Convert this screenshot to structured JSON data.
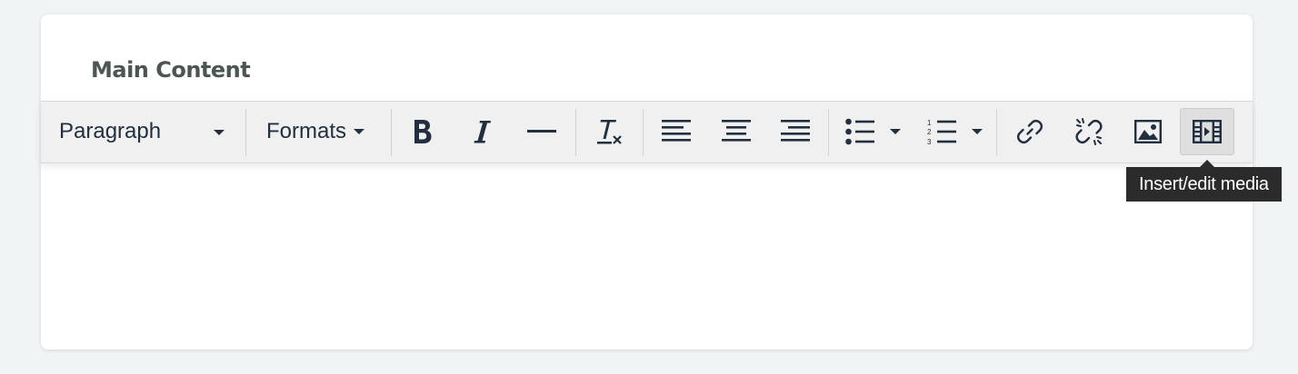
{
  "section": {
    "title": "Main Content"
  },
  "toolbar": {
    "block_format": "Paragraph",
    "formats_label": "Formats",
    "buttons": [
      {
        "icon": "bold-icon"
      },
      {
        "icon": "italic-icon"
      },
      {
        "icon": "horizontal-rule-icon"
      },
      {
        "icon": "clear-formatting-icon"
      },
      {
        "icon": "align-left-icon"
      },
      {
        "icon": "align-center-icon"
      },
      {
        "icon": "align-right-icon"
      },
      {
        "icon": "bullet-list-icon"
      },
      {
        "icon": "numbered-list-icon"
      },
      {
        "icon": "link-icon"
      },
      {
        "icon": "unlink-icon"
      },
      {
        "icon": "image-icon"
      },
      {
        "icon": "media-icon"
      }
    ]
  },
  "tooltip": {
    "text": "Insert/edit media"
  },
  "colors": {
    "background": "#f0f4f4",
    "title": "#4b5553",
    "icon": "#222f3e",
    "toolbar": "#f0f0f0",
    "tooltip_bg": "#2b2b2b"
  }
}
